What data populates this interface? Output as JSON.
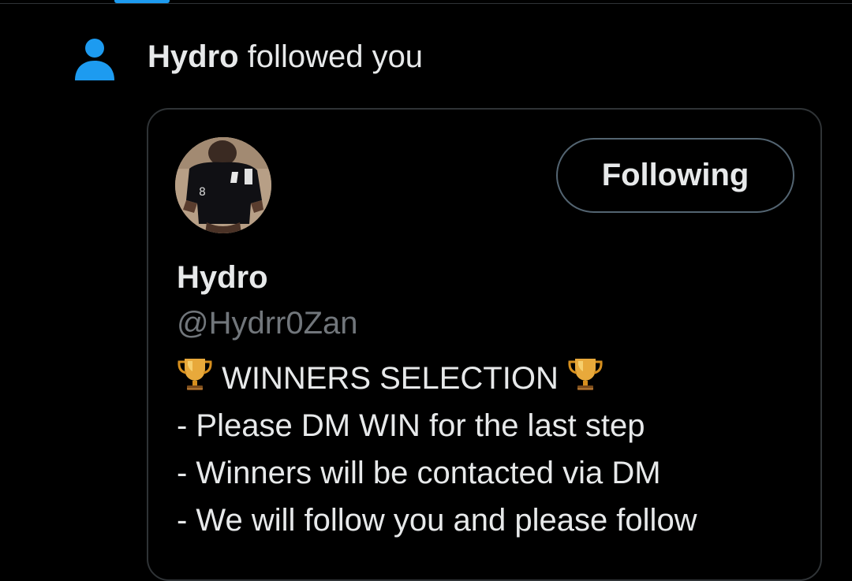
{
  "notification": {
    "icon": "person-icon",
    "icon_color": "#1d9bf0",
    "actor_name": "Hydro",
    "action_text": " followed you"
  },
  "profile_card": {
    "display_name": "Hydro",
    "handle": "@Hydrr0Zan",
    "follow_button_label": "Following",
    "bio": {
      "line1_text": " WINNERS SELECTION ",
      "line1_icons": [
        "trophy-icon",
        "trophy-icon"
      ],
      "line2": "- Please DM WIN for the last step",
      "line3": "- Winners will be contacted via DM",
      "line4": "- We will follow you and please follow"
    }
  },
  "colors": {
    "background": "#000000",
    "text_primary": "#e7e9ea",
    "text_secondary": "#71767b",
    "border": "#2f3336",
    "accent": "#1d9bf0"
  }
}
